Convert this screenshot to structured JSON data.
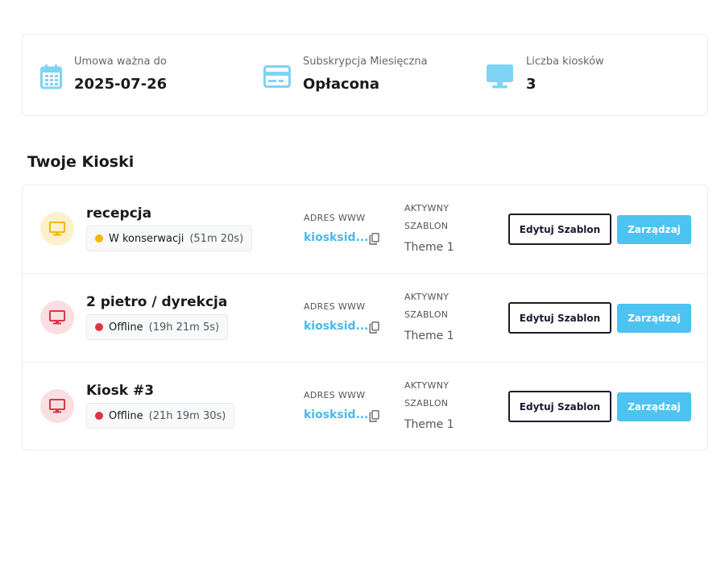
{
  "summary": {
    "contract": {
      "label": "Umowa ważna do",
      "value": "2025-07-26",
      "icon": "calendar-icon"
    },
    "subscription": {
      "label": "Subskrypcja Miesięczna",
      "value": "Opłacona",
      "icon": "credit-card-icon"
    },
    "kiosk_count": {
      "label": "Liczba kiosków",
      "value": "3",
      "icon": "monitor-icon"
    }
  },
  "colors": {
    "accent": "#4cc3f0",
    "link": "#4ab8e8",
    "warning": "#f5b700",
    "offline": "#dc3545",
    "icon_blue": "#7fd3f5"
  },
  "kiosks_title": "Twoje Kioski",
  "kiosks": [
    {
      "name": "recepcja",
      "status": "W konserwacji",
      "status_type": "warning",
      "duration": "(51m 20s)",
      "url_label": "ADRES WWW",
      "url": "kiosksid...",
      "template_label_1": "AKTYWNY",
      "template_label_2": "SZABLON",
      "template": "Theme 1",
      "edit_label": "Edytuj Szablon",
      "manage_label": "Zarządzaj"
    },
    {
      "name": "2 pietro / dyrekcja",
      "status": "Offline",
      "status_type": "offline",
      "duration": "(19h 21m 5s)",
      "url_label": "ADRES WWW",
      "url": "kiosksid...",
      "template_label_1": "AKTYWNY",
      "template_label_2": "SZABLON",
      "template": "Theme 1",
      "edit_label": "Edytuj Szablon",
      "manage_label": "Zarządzaj"
    },
    {
      "name": "Kiosk #3",
      "status": "Offline",
      "status_type": "offline",
      "duration": "(21h 19m 30s)",
      "url_label": "ADRES WWW",
      "url": "kiosksid...",
      "template_label_1": "AKTYWNY",
      "template_label_2": "SZABLON",
      "template": "Theme 1",
      "edit_label": "Edytuj Szablon",
      "manage_label": "Zarządzaj"
    }
  ]
}
